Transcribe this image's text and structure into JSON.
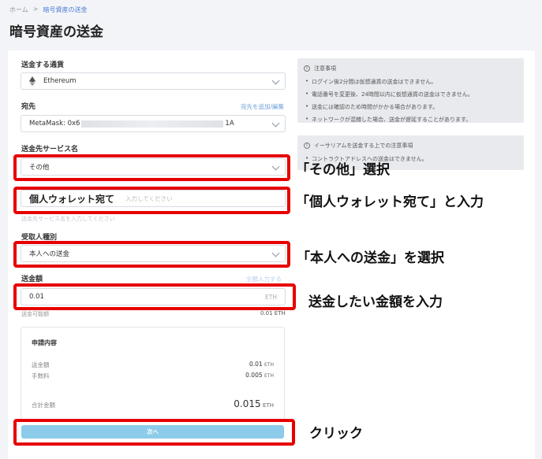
{
  "breadcrumb": {
    "home": "ホーム",
    "sep": ">",
    "current": "暗号資産の送金"
  },
  "page_title": "暗号資産の送金",
  "form": {
    "currency_label": "送金する通貨",
    "currency_value": "Ethereum",
    "dest_label": "宛先",
    "dest_link": "宛先を追加/編集",
    "dest_prefix": "MetaMask: 0x6",
    "dest_suffix": "1A",
    "service_label": "送金先サービス名",
    "service_value": "その他",
    "wallet_value": "個人ウォレット宛て",
    "wallet_placeholder": "入力してください",
    "wallet_hint": "送金先サービス名を入力してください",
    "recipient_label": "受取人種別",
    "recipient_value": "本人への送金",
    "amount_label": "送金額",
    "amount_link": "全額入力する",
    "amount_value": "0.01",
    "amount_unit": "ETH",
    "available_label": "送金可能額",
    "available_value": "0.01 ETH"
  },
  "summary": {
    "title": "申請内容",
    "amount_label": "送金額",
    "amount_value": "0.01",
    "fee_label": "手数料",
    "fee_value": "0.005",
    "total_label": "合計金額",
    "total_value": "0.015",
    "unit": "ETH"
  },
  "next_button": "次へ",
  "notes": {
    "title": "注意事項",
    "items": [
      "ログイン後2分間は仮想通貨の送金はできません。",
      "電話番号を変更後、24時間以内に仮想通貨の送金はできません。",
      "送金には確認のため時間がかかる場合があります。",
      "ネットワークが混雑した場合、送金が遅延することがあります。"
    ],
    "eth_title": "イーサリアムを送金する上での注意事項",
    "eth_item": "コントラクトアドレスへの送金はできません。"
  },
  "annotations": {
    "select_other": "「その他」選択",
    "personal_wallet": "「個人ウォレット宛て」と入力",
    "self_transfer": "「本人への送金」を選択",
    "enter_amount": "送金したい金額を入力",
    "click": "クリック"
  },
  "colors": {
    "highlight": "#e60000",
    "button": "#8ccbe9",
    "link": "#4a7bd6"
  }
}
